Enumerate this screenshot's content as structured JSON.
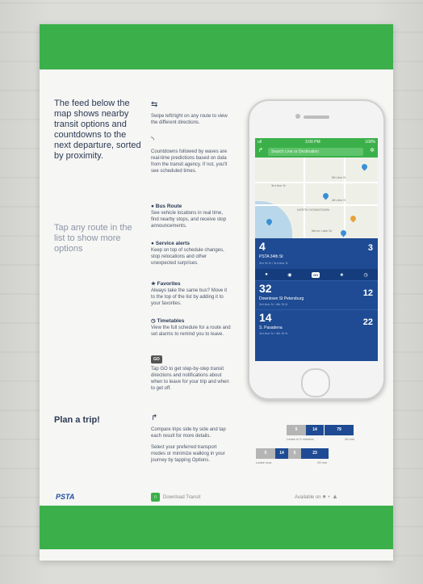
{
  "left": {
    "feed_text": "The feed below the map shows nearby transit options and countdowns to the next departure, sorted by proximity.",
    "tap_text": "Tap any route in the list to show more options",
    "plan_text": "Plan a trip!"
  },
  "features": {
    "swipe_desc": "Swipe left/right on any route to view the different directions.",
    "waves_desc": "Countdowns followed by waves are real-time predictions based on data from the transit agency. If not, you'll see scheduled times.",
    "bus_route_title": "Bus Route",
    "bus_route_desc": "See vehicle locations in real time, find nearby stops, and receive stop announcements.",
    "alerts_title": "Service alerts",
    "alerts_desc": "Keep on top of schedule changes, stop relocations and other unexpected surprises.",
    "favorites_title": "Favorites",
    "favorites_desc": "Always take the same bus? Move it to the top of the list by adding it to your favorites.",
    "timetables_title": "Timetables",
    "timetables_desc": "View the full schedule for a route and set alarms to remind you to leave.",
    "go_label": "GO",
    "go_desc": "Tap GO to get step-by-step transit directions and notifications about when to leave for your trip and when to get off.",
    "compare_desc": "Compare trips side by side and tap each result for more details.",
    "select_desc": "Select your preferred transport modes or minimize walking in your journey by tapping Options."
  },
  "phone": {
    "status_left": "ull",
    "status_time": "3:00 PM",
    "status_right": "100%",
    "search_placeholder": "Search Line or Destination",
    "map_labels": [
      "NORTH DOWNTOWN",
      "5th Ave N",
      "4th Ave N",
      "3rd Ave N",
      "Mirror Lake Dr"
    ],
    "routes": [
      {
        "num": "4",
        "stop": "PSTA 34th St",
        "sub": "3rd St N / 3rd Ave N",
        "min": "3"
      },
      {
        "num": "32",
        "stop": "Downtown St Petersburg",
        "sub": "3rd Ave N / 4th St N",
        "min": "12"
      },
      {
        "num": "14",
        "stop": "S. Pasadena",
        "sub": "3rd Ave N / 4th St N",
        "min": "22"
      }
    ],
    "go_btn": "GO"
  },
  "trips": {
    "row1": [
      "5",
      "14",
      "79"
    ],
    "row1_left": "Leave in 5 minutes",
    "row1_right": "26 min",
    "row2": [
      "5",
      "14",
      "5",
      "23"
    ],
    "row2_left": "Leave now",
    "row2_right": "29 min"
  },
  "footer": {
    "brand": "PSTA",
    "download": "Download Transit",
    "available": "Available on"
  },
  "colors": {
    "green": "#3bb04a",
    "navy": "#1e4b93"
  }
}
